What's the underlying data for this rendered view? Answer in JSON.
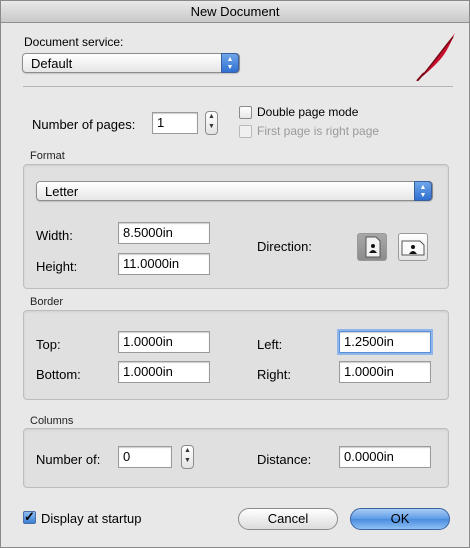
{
  "window": {
    "title": "New Document"
  },
  "document_service": {
    "label": "Document service:",
    "value": "Default"
  },
  "pages": {
    "label": "Number of pages:",
    "value": "1",
    "double_page_label": "Double page mode",
    "double_page_checked": false,
    "first_right_label": "First page is right page",
    "first_right_enabled": false
  },
  "format": {
    "section_label": "Format",
    "paper": "Letter",
    "width_label": "Width:",
    "width_value": "8.5000in",
    "height_label": "Height:",
    "height_value": "11.0000in",
    "direction_label": "Direction:",
    "direction_selected": "portrait"
  },
  "border": {
    "section_label": "Border",
    "top_label": "Top:",
    "top_value": "1.0000in",
    "bottom_label": "Bottom:",
    "bottom_value": "1.0000in",
    "left_label": "Left:",
    "left_value": "1.2500in",
    "right_label": "Right:",
    "right_value": "1.0000in"
  },
  "columns": {
    "section_label": "Columns",
    "number_label": "Number of:",
    "number_value": "0",
    "distance_label": "Distance:",
    "distance_value": "0.0000in"
  },
  "footer": {
    "startup_label": "Display at startup",
    "startup_checked": true,
    "cancel_label": "Cancel",
    "ok_label": "OK"
  },
  "colors": {
    "accent": "#4a8ce0",
    "logo": "#c8102e"
  },
  "icons": [
    "feather-logo-icon",
    "portrait-icon",
    "landscape-icon",
    "popup-arrows-icon",
    "stepper-icon"
  ]
}
